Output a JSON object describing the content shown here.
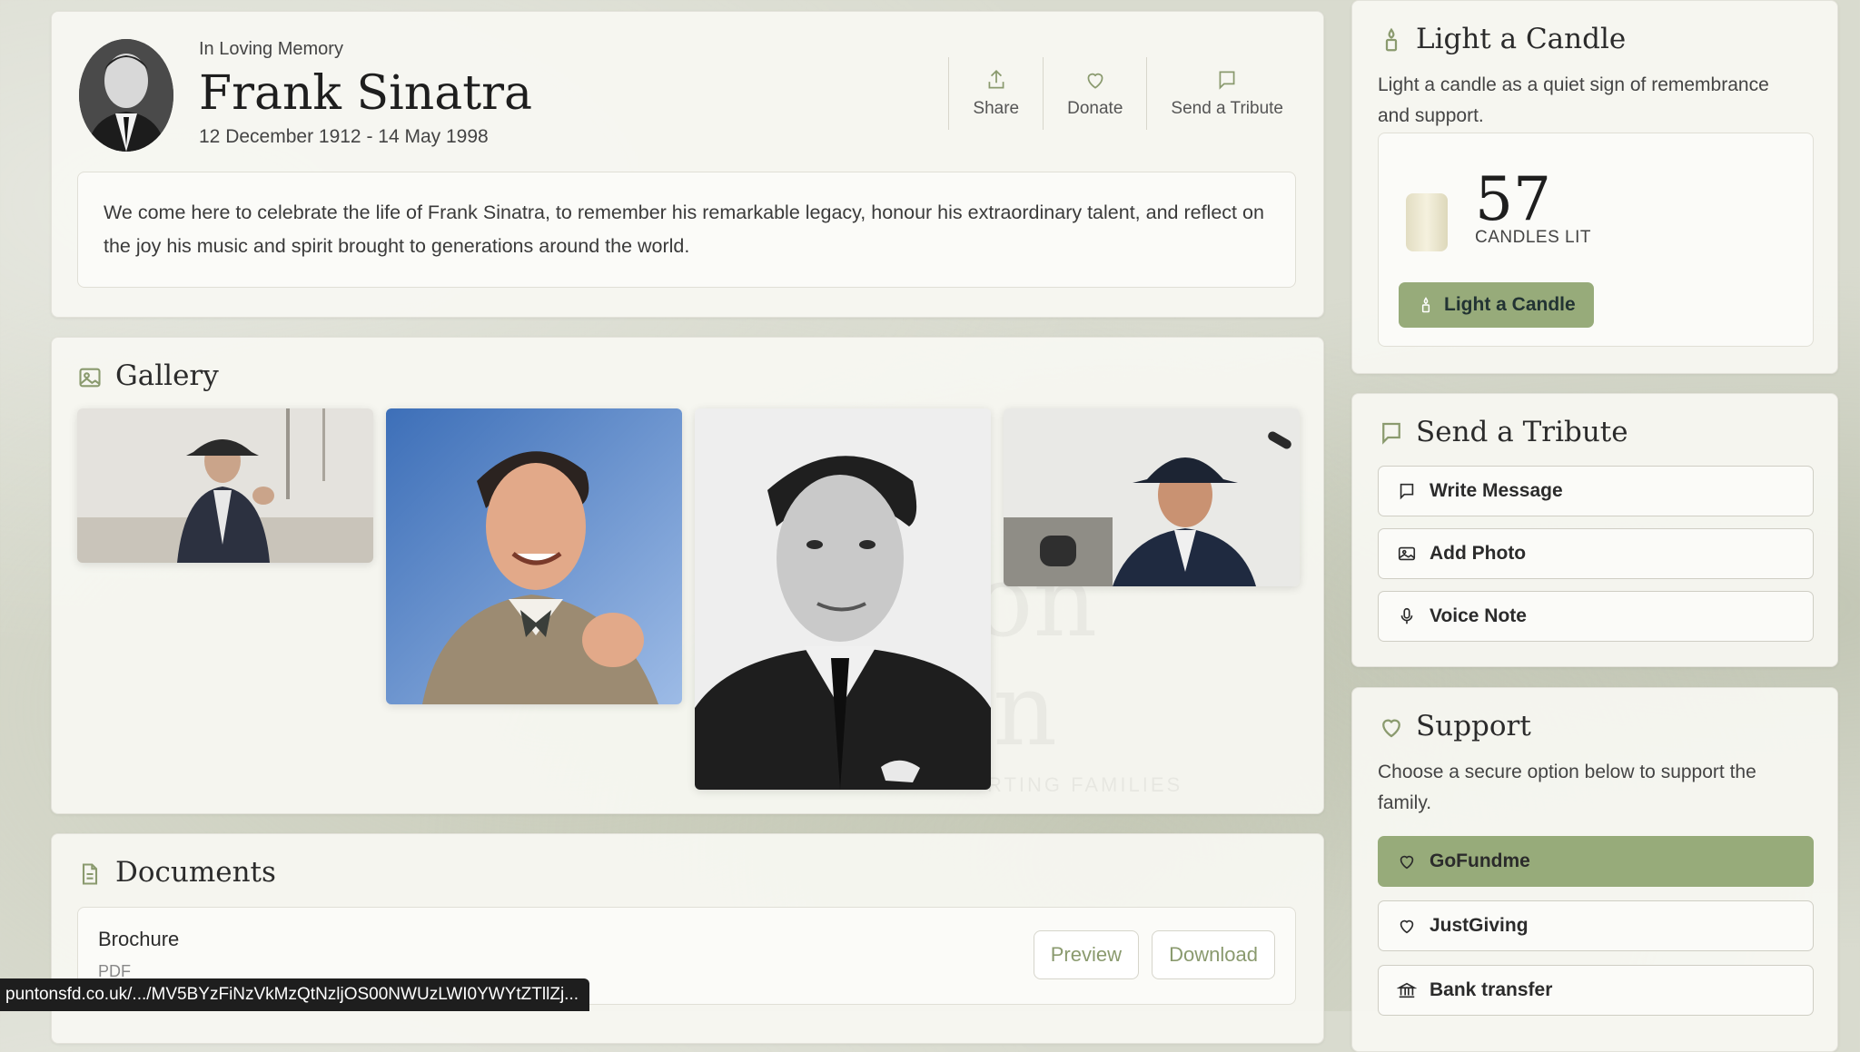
{
  "header": {
    "subtitle": "In Loving Memory",
    "name": "Frank Sinatra",
    "dates": "12 December 1912 - 14 May 1998",
    "actions": [
      {
        "label": "Share",
        "icon": "share-icon"
      },
      {
        "label": "Donate",
        "icon": "heart-icon"
      },
      {
        "label": "Send a Tribute",
        "icon": "chat-icon"
      }
    ],
    "intro": "We come here to celebrate the life of Frank Sinatra, to remember his remarkable legacy, honour his extraordinary talent, and reflect on the joy his music and spirit brought to generations around the world."
  },
  "gallery": {
    "title": "Gallery",
    "icon": "image-icon",
    "watermark": "ton\non",
    "watermark_sub": "RTING FAMILIES"
  },
  "documents": {
    "title": "Documents",
    "icon": "document-icon",
    "items": [
      {
        "name": "Brochure",
        "type": "PDF",
        "preview_label": "Preview",
        "download_label": "Download"
      }
    ]
  },
  "candle": {
    "title": "Light a Candle",
    "icon": "candle-icon",
    "description": "Light a candle as a quiet sign of remembrance and support.",
    "count": "57",
    "count_label": "CANDLES LIT",
    "button_label": "Light a Candle"
  },
  "tribute": {
    "title": "Send a Tribute",
    "icon": "chat-icon",
    "options": [
      {
        "label": "Write Message",
        "icon": "chat-icon"
      },
      {
        "label": "Add Photo",
        "icon": "image-icon"
      },
      {
        "label": "Voice Note",
        "icon": "microphone-icon"
      }
    ]
  },
  "support": {
    "title": "Support",
    "icon": "heart-icon",
    "description": "Choose a secure option below to support the family.",
    "options": [
      {
        "label": "GoFundme",
        "icon": "heart-icon"
      },
      {
        "label": "JustGiving",
        "icon": "heart-icon"
      },
      {
        "label": "Bank transfer",
        "icon": "bank-icon"
      }
    ]
  },
  "status_bar": {
    "url": "puntonsfd.co.uk/.../MV5BYzFiNzVkMzQtNzljOS00NWUzLWI0YWYtZTllZj..."
  },
  "colors": {
    "accent": "#97ab7a",
    "icon_green": "#8a9a6e",
    "background": "#d9dbcf"
  }
}
